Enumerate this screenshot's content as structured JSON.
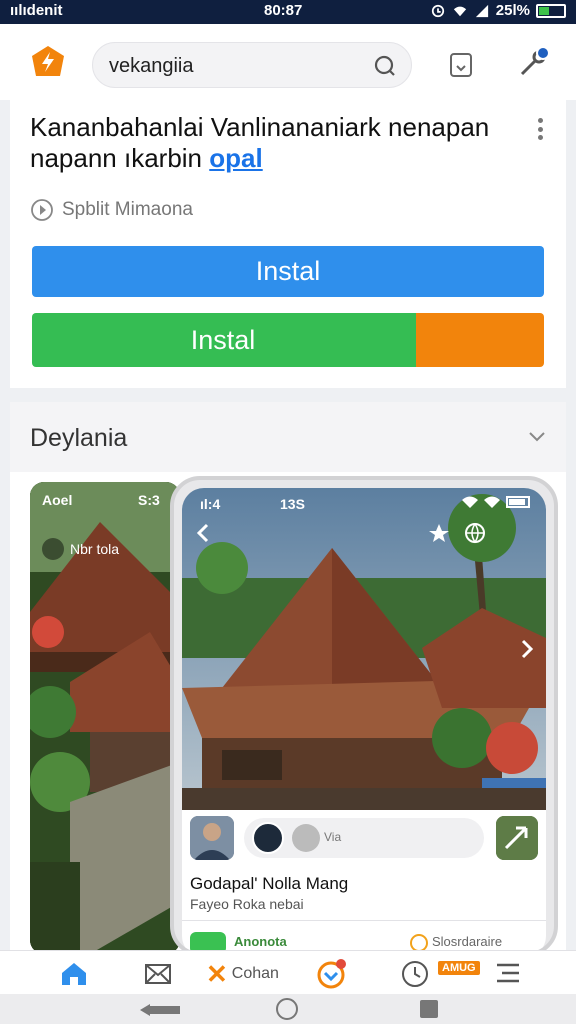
{
  "status_bar": {
    "carrier": "ıılıdenit",
    "time": "80:87",
    "battery": "25l%"
  },
  "search": {
    "value": "vekangiia"
  },
  "listing": {
    "headline": "Kananbahanlai Vanlinananiark nenapan napann ıkarbin",
    "headline_link": "opal",
    "play_label": "Spblit Mimaona",
    "install_primary": "Instal",
    "install_secondary": "Instal"
  },
  "section": {
    "title": "Deylania"
  },
  "gallery": {
    "back_shot": {
      "status_left": "Aoel",
      "status_right": "S:3",
      "chip_label": "Nbr tola"
    },
    "phone": {
      "status_left": "ıl:4",
      "status_center": "13S",
      "title": "Godapal' Nolla Mang",
      "subtitle": "Fayeo Roka nebai",
      "pill_text": "Via",
      "green_label": "Anonota",
      "orange_label": "Slosrdaraire"
    }
  },
  "bottom_nav": {
    "cohan_label": "Cohan",
    "tag_label": "AMUG"
  },
  "colors": {
    "primary_blue": "#2f8fec",
    "install_green": "#35bd53",
    "accent_orange": "#f2840c",
    "status_bar": "#0f1f3f"
  }
}
